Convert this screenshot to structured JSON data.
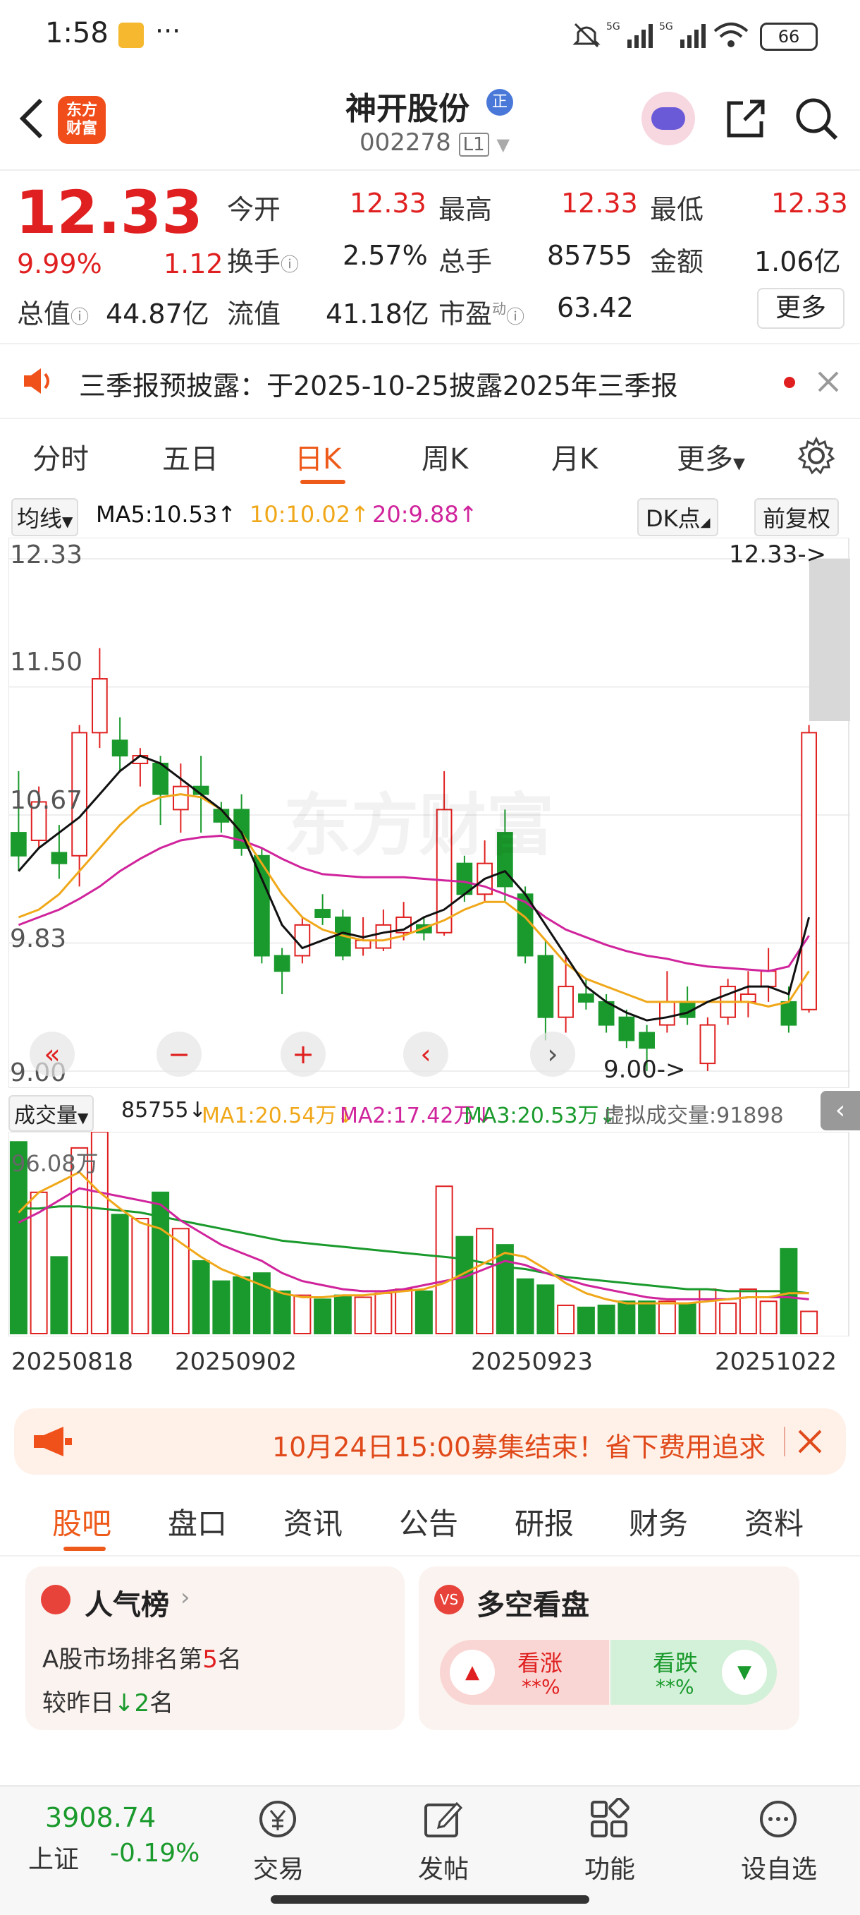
{
  "status": {
    "time": "1:58",
    "battery": "66",
    "dots": "···"
  },
  "header": {
    "logo_line1": "东方",
    "logo_line2": "财富",
    "stock_name": "神开股份",
    "stock_code": "002278",
    "level_badge": "L1",
    "name_badge": "正"
  },
  "quote": {
    "price": "12.33",
    "change_pct": "9.99%",
    "change_amt": "1.12",
    "open_label": "今开",
    "open": "12.33",
    "high_label": "最高",
    "high": "12.33",
    "low_label": "最低",
    "low": "12.33",
    "turnover_label": "换手",
    "turnover": "2.57%",
    "volume_label": "总手",
    "volume": "85755",
    "amount_label": "金额",
    "amount": "1.06亿",
    "mktcap_label": "总值",
    "mktcap": "44.87亿",
    "float_label": "流值",
    "float_cap": "41.18亿",
    "pe_label": "市盈",
    "pe_sup": "动",
    "pe": "63.42",
    "more_button": "更多"
  },
  "notice": {
    "text": "三季报预披露：于2025-10-25披露2025年三季报"
  },
  "chart_tabs": [
    "分时",
    "五日",
    "日K",
    "周K",
    "月K",
    "更多"
  ],
  "active_chart_tab": "日K",
  "ma_row": {
    "selector": "均线",
    "ma5": "MA5:10.53",
    "ma10": "10:10.02",
    "ma20": "20:9.88",
    "dk_button": "DK点",
    "fq_button": "前复权"
  },
  "kline_labels": {
    "y_top": "12.33",
    "y_2": "11.50",
    "y_3": "10.67",
    "y_4": "9.83",
    "y_bottom": "9.00",
    "max_marker": "12.33->",
    "min_marker": "9.00->",
    "watermark": "东方财富"
  },
  "volume_row": {
    "selector": "成交量",
    "vol": "85755",
    "ma1": "MA1:20.54万",
    "ma2": "MA2:17.42万",
    "ma3": "MA3:20.53万",
    "virtual": "虚拟成交量:91898",
    "y_top": "96.08万"
  },
  "dates": [
    "20250818",
    "20250902",
    "20250923",
    "20251022"
  ],
  "colors": {
    "up": "#e02020",
    "down": "#1a9a2c",
    "ma5": "#111111",
    "ma10": "#f0a81a",
    "ma20": "#d0249c",
    "accent": "#ee5a1a"
  },
  "chart_data": {
    "type": "candlestick",
    "y_range": [
      9.0,
      12.33
    ],
    "candles": [
      [
        10.55,
        10.4,
        10.95,
        10.3
      ],
      [
        10.5,
        10.75,
        10.85,
        10.45
      ],
      [
        10.42,
        10.35,
        10.6,
        10.25
      ],
      [
        10.4,
        11.2,
        11.25,
        10.2
      ],
      [
        11.2,
        11.55,
        11.75,
        11.1
      ],
      [
        11.15,
        11.05,
        11.3,
        10.95
      ],
      [
        11.0,
        11.05,
        11.1,
        10.85
      ],
      [
        11.0,
        10.8,
        11.05,
        10.6
      ],
      [
        10.7,
        10.85,
        11.0,
        10.55
      ],
      [
        10.85,
        10.8,
        11.05,
        10.55
      ],
      [
        10.7,
        10.62,
        10.75,
        10.55
      ],
      [
        10.7,
        10.45,
        10.8,
        10.4
      ],
      [
        10.4,
        9.75,
        10.45,
        9.7
      ],
      [
        9.75,
        9.65,
        9.8,
        9.5
      ],
      [
        9.75,
        9.95,
        10.0,
        9.7
      ],
      [
        10.05,
        10.0,
        10.15,
        9.95
      ],
      [
        10.0,
        9.75,
        10.05,
        9.72
      ],
      [
        9.8,
        9.85,
        10.0,
        9.75
      ],
      [
        9.8,
        9.95,
        10.05,
        9.78
      ],
      [
        9.9,
        10.0,
        10.1,
        9.85
      ],
      [
        9.95,
        9.9,
        10.0,
        9.85
      ],
      [
        9.9,
        10.7,
        10.95,
        9.88
      ],
      [
        10.35,
        10.15,
        10.4,
        10.1
      ],
      [
        10.15,
        10.35,
        10.5,
        10.1
      ],
      [
        10.55,
        10.2,
        10.7,
        10.1
      ],
      [
        10.15,
        9.75,
        10.2,
        9.7
      ],
      [
        9.75,
        9.35,
        9.85,
        9.2
      ],
      [
        9.35,
        9.55,
        9.75,
        9.25
      ],
      [
        9.5,
        9.45,
        9.6,
        9.4
      ],
      [
        9.45,
        9.3,
        9.5,
        9.25
      ],
      [
        9.35,
        9.2,
        9.4,
        9.15
      ],
      [
        9.25,
        9.15,
        9.3,
        9.0
      ],
      [
        9.3,
        9.45,
        9.65,
        9.25
      ],
      [
        9.45,
        9.35,
        9.55,
        9.3
      ],
      [
        9.05,
        9.3,
        9.35,
        9.0
      ],
      [
        9.35,
        9.55,
        9.6,
        9.3
      ],
      [
        9.45,
        9.5,
        9.65,
        9.35
      ],
      [
        9.55,
        9.65,
        9.8,
        9.45
      ],
      [
        9.45,
        9.3,
        9.55,
        9.25
      ],
      [
        9.4,
        11.2,
        11.25,
        9.38
      ]
    ],
    "ma5": [
      10.3,
      10.45,
      10.55,
      10.65,
      10.8,
      10.95,
      11.05,
      11.0,
      10.9,
      10.8,
      10.7,
      10.55,
      10.25,
      9.95,
      9.8,
      9.85,
      9.9,
      9.87,
      9.9,
      9.92,
      10.0,
      10.05,
      10.15,
      10.25,
      10.3,
      10.15,
      9.95,
      9.75,
      9.55,
      9.45,
      9.38,
      9.33,
      9.35,
      9.38,
      9.45,
      9.5,
      9.55,
      9.55,
      9.5,
      10.0
    ],
    "ma10": [
      10.0,
      10.05,
      10.15,
      10.3,
      10.45,
      10.6,
      10.72,
      10.78,
      10.8,
      10.78,
      10.7,
      10.55,
      10.35,
      10.15,
      10.0,
      9.92,
      9.88,
      9.85,
      9.85,
      9.88,
      9.93,
      9.98,
      10.05,
      10.1,
      10.1,
      10.0,
      9.85,
      9.7,
      9.6,
      9.55,
      9.5,
      9.45,
      9.45,
      9.45,
      9.45,
      9.45,
      9.45,
      9.42,
      9.45,
      9.65
    ],
    "ma20": [
      9.95,
      10.0,
      10.05,
      10.12,
      10.2,
      10.3,
      10.38,
      10.45,
      10.5,
      10.52,
      10.53,
      10.5,
      10.45,
      10.38,
      10.32,
      10.28,
      10.27,
      10.26,
      10.26,
      10.26,
      10.25,
      10.24,
      10.23,
      10.2,
      10.15,
      10.1,
      10.0,
      9.92,
      9.87,
      9.82,
      9.78,
      9.75,
      9.73,
      9.7,
      9.68,
      9.67,
      9.66,
      9.65,
      9.68,
      9.88
    ],
    "volume_max": "96.08万",
    "volumes": [
      95,
      70,
      38,
      92,
      100,
      59,
      57,
      70,
      52,
      36,
      26,
      28,
      30,
      21,
      19,
      17,
      19,
      18,
      20,
      22,
      21,
      73,
      48,
      52,
      44,
      27,
      24,
      14,
      13,
      14,
      16,
      16,
      16,
      15,
      22,
      15,
      22,
      16,
      42,
      11
    ],
    "vol_ma1": [
      60,
      70,
      75,
      80,
      70,
      62,
      55,
      52,
      45,
      38,
      32,
      28,
      24,
      20,
      18,
      18,
      19,
      19,
      20,
      21,
      22,
      25,
      30,
      35,
      40,
      38,
      32,
      25,
      20,
      17,
      15,
      15,
      15,
      15,
      16,
      17,
      18,
      18,
      20,
      20
    ],
    "vol_ma2": [
      55,
      60,
      66,
      72,
      70,
      68,
      66,
      64,
      56,
      50,
      44,
      40,
      36,
      30,
      26,
      24,
      22,
      21,
      21,
      22,
      24,
      26,
      28,
      32,
      36,
      34,
      30,
      27,
      24,
      22,
      20,
      18,
      17,
      17,
      17,
      17,
      18,
      18,
      18,
      17
    ],
    "vol_ma3": [
      62,
      62,
      63,
      63,
      62,
      61,
      60,
      58,
      56,
      54,
      52,
      50,
      48,
      46,
      45,
      44,
      43,
      42,
      41,
      40,
      39,
      38,
      37,
      35,
      33,
      32,
      30,
      28,
      27,
      26,
      25,
      24,
      23,
      22,
      22,
      21,
      21,
      21,
      21,
      20
    ]
  },
  "ad_banner": {
    "text": "10月24日15:00募集结束！省下费用追求"
  },
  "sub_tabs": [
    "股吧",
    "盘口",
    "资讯",
    "公告",
    "研报",
    "财务",
    "资料"
  ],
  "active_sub_tab": "股吧",
  "popularity_card": {
    "title": "人气榜",
    "line1_prefix": "A股市场排名第",
    "rank": "5",
    "line1_suffix": "名",
    "line2_prefix": "较昨日",
    "change": "2",
    "line2_suffix": "名"
  },
  "sentiment_card": {
    "title": "多空看盘",
    "bull_label": "看涨",
    "bull_value": "**%",
    "bear_label": "看跌",
    "bear_value": "**%"
  },
  "bottom_nav": {
    "index_value": "3908.74",
    "index_name": "上证",
    "index_change": "-0.19%",
    "items": [
      "交易",
      "发帖",
      "功能",
      "设自选"
    ]
  }
}
